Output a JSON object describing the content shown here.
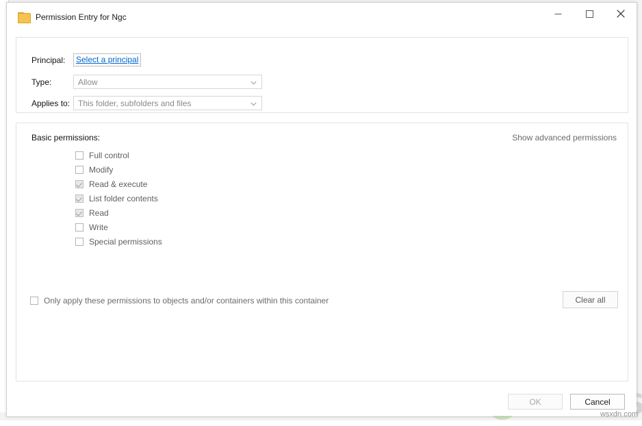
{
  "window": {
    "title": "Permission Entry for Ngc",
    "icon": "folder-icon",
    "caption": {
      "minimize": "minimize-icon",
      "maximize": "maximize-icon",
      "close": "close-icon"
    }
  },
  "principal_group": {
    "principal_label": "Principal:",
    "principal_link": "Select a principal",
    "type_label": "Type:",
    "type_value": "Allow",
    "applies_to_label": "Applies to:",
    "applies_to_value": "This folder, subfolders and files"
  },
  "permissions_group": {
    "basic_permissions_label": "Basic permissions:",
    "show_advanced_label": "Show advanced permissions",
    "items": [
      {
        "label": "Full control",
        "checked": false
      },
      {
        "label": "Modify",
        "checked": false
      },
      {
        "label": "Read & execute",
        "checked": true
      },
      {
        "label": "List folder contents",
        "checked": true
      },
      {
        "label": "Read",
        "checked": true
      },
      {
        "label": "Write",
        "checked": false
      },
      {
        "label": "Special permissions",
        "checked": false
      }
    ],
    "only_apply_label": "Only apply these permissions to objects and/or containers within this container",
    "only_apply_checked": false,
    "clear_all_label": "Clear all"
  },
  "footer": {
    "ok_label": "OK",
    "cancel_label": "Cancel"
  },
  "watermark": {
    "text": "PPUALS"
  },
  "overlay": {
    "site_url": "wsxdn.com"
  },
  "colors": {
    "link": "#0066cc",
    "folder": "#f7c34f",
    "watermark_green": "#7ab648"
  }
}
